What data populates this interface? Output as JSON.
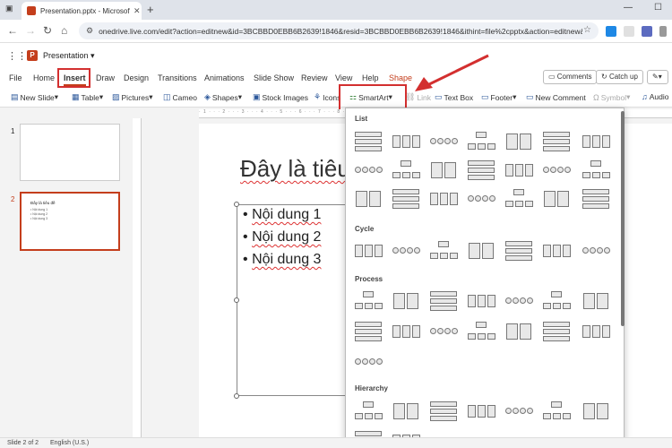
{
  "browser": {
    "tab_title": "Presentation.pptx - Microsoft P",
    "tab_close": "✕",
    "new_tab": "+",
    "url": "onedrive.live.com/edit?action=editnew&id=3BCBBD0EBB6B2639!1846&resid=3BCBBD0EBB6B2639!1846&ithint=file%2cpptx&action=editnew&ct...",
    "window_minimize": "—",
    "window_maximize": "☐"
  },
  "app": {
    "doc_title": "Presentation"
  },
  "ribbon": {
    "tabs": [
      "File",
      "Home",
      "Insert",
      "Draw",
      "Design",
      "Transitions",
      "Animations",
      "Slide Show",
      "Review",
      "View",
      "Help",
      "Shape"
    ],
    "active_tab": "Insert",
    "right_buttons": [
      "Comments",
      "Catch up"
    ]
  },
  "toolbar": {
    "items": [
      {
        "label": "New Slide",
        "icon": "new-slide-icon"
      },
      {
        "label": "Table",
        "icon": "table-icon"
      },
      {
        "label": "Pictures",
        "icon": "pictures-icon"
      },
      {
        "label": "Cameo",
        "icon": "cameo-icon"
      },
      {
        "label": "Shapes",
        "icon": "shapes-icon"
      },
      {
        "label": "Stock Images",
        "icon": "stock-images-icon"
      },
      {
        "label": "Icons",
        "icon": "icons-icon"
      },
      {
        "label": "SmartArt",
        "icon": "smartart-icon"
      },
      {
        "label": "Link",
        "icon": "link-icon"
      },
      {
        "label": "Text Box",
        "icon": "textbox-icon"
      },
      {
        "label": "Footer",
        "icon": "footer-icon"
      },
      {
        "label": "New Comment",
        "icon": "comment-icon"
      },
      {
        "label": "Symbol",
        "icon": "symbol-icon"
      },
      {
        "label": "Audio",
        "icon": "audio-icon"
      }
    ]
  },
  "slides": [
    {
      "number": "1"
    },
    {
      "number": "2",
      "title": "Đây là tiêu đề",
      "lines": [
        "• Nội dung 1",
        "• Nội dung 2",
        "• Nội dung 3"
      ]
    }
  ],
  "slide": {
    "title": "Đây là tiêu",
    "bullets": [
      "Nội dung 1",
      "Nội dung 2",
      "Nội dung 3"
    ],
    "bullet_char": "•"
  },
  "smartart": {
    "sections": [
      "List",
      "Cycle",
      "Process",
      "Hierarchy"
    ]
  },
  "statusbar": {
    "slide_info": "Slide 2 of 2",
    "language": "English (U.S.)"
  },
  "colors": {
    "accent": "#c43e1c",
    "highlight": "#d32f2f"
  }
}
